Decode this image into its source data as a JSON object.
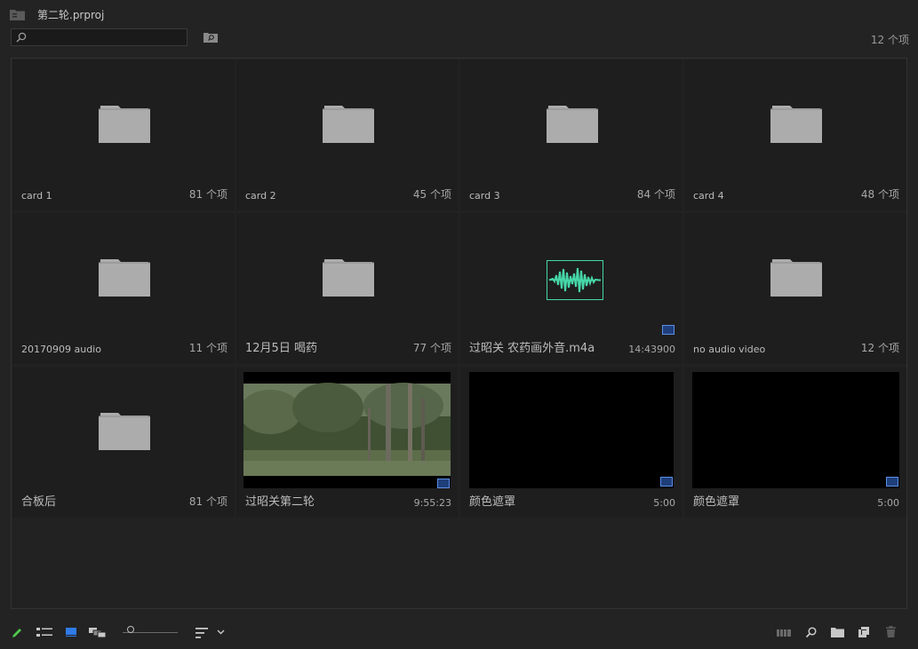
{
  "window": {
    "title": "第二轮.prproj"
  },
  "search": {
    "placeholder": "",
    "value": ""
  },
  "item_count": "12 个项",
  "items": [
    {
      "name": "card 1",
      "meta": "81 个项",
      "type": "folder"
    },
    {
      "name": "card 2",
      "meta": "45 个项",
      "type": "folder"
    },
    {
      "name": "card 3",
      "meta": "84 个项",
      "type": "folder"
    },
    {
      "name": "card 4",
      "meta": "48 个项",
      "type": "folder"
    },
    {
      "name": "20170909 audio",
      "meta": "11 个项",
      "type": "folder"
    },
    {
      "name": "12月5日  喝药",
      "meta": "77 个项",
      "type": "folder"
    },
    {
      "name": "过昭关 农药画外音.m4a",
      "meta": "14:43900",
      "type": "audio"
    },
    {
      "name": "no audio video",
      "meta": "12 个项",
      "type": "folder"
    },
    {
      "name": "合板后",
      "meta": "81 个项",
      "type": "folder"
    },
    {
      "name": "过昭关第二轮",
      "meta": "9:55:23",
      "type": "sequence"
    },
    {
      "name": "颜色遮罩",
      "meta": "5:00",
      "type": "color-matte"
    },
    {
      "name": "颜色遮罩",
      "meta": "5:00",
      "type": "color-matte"
    }
  ],
  "colors": {
    "panel_bg": "#232323",
    "tile_bg": "#1e1e1e",
    "folder": "#acacac",
    "waveform": "#46d7a8",
    "accent_blue": "#2f7be8",
    "pencil_green": "#4ec94e"
  },
  "footer_icons": [
    "pencil-icon",
    "list-view-icon",
    "icon-view-icon",
    "freeform-view-icon",
    "zoom-slider",
    "sort-icon",
    "chevron-down-icon",
    "automate-to-sequence-icon",
    "find-icon",
    "new-bin-icon",
    "new-item-icon",
    "trash-icon"
  ],
  "zoom_level": 0.1
}
